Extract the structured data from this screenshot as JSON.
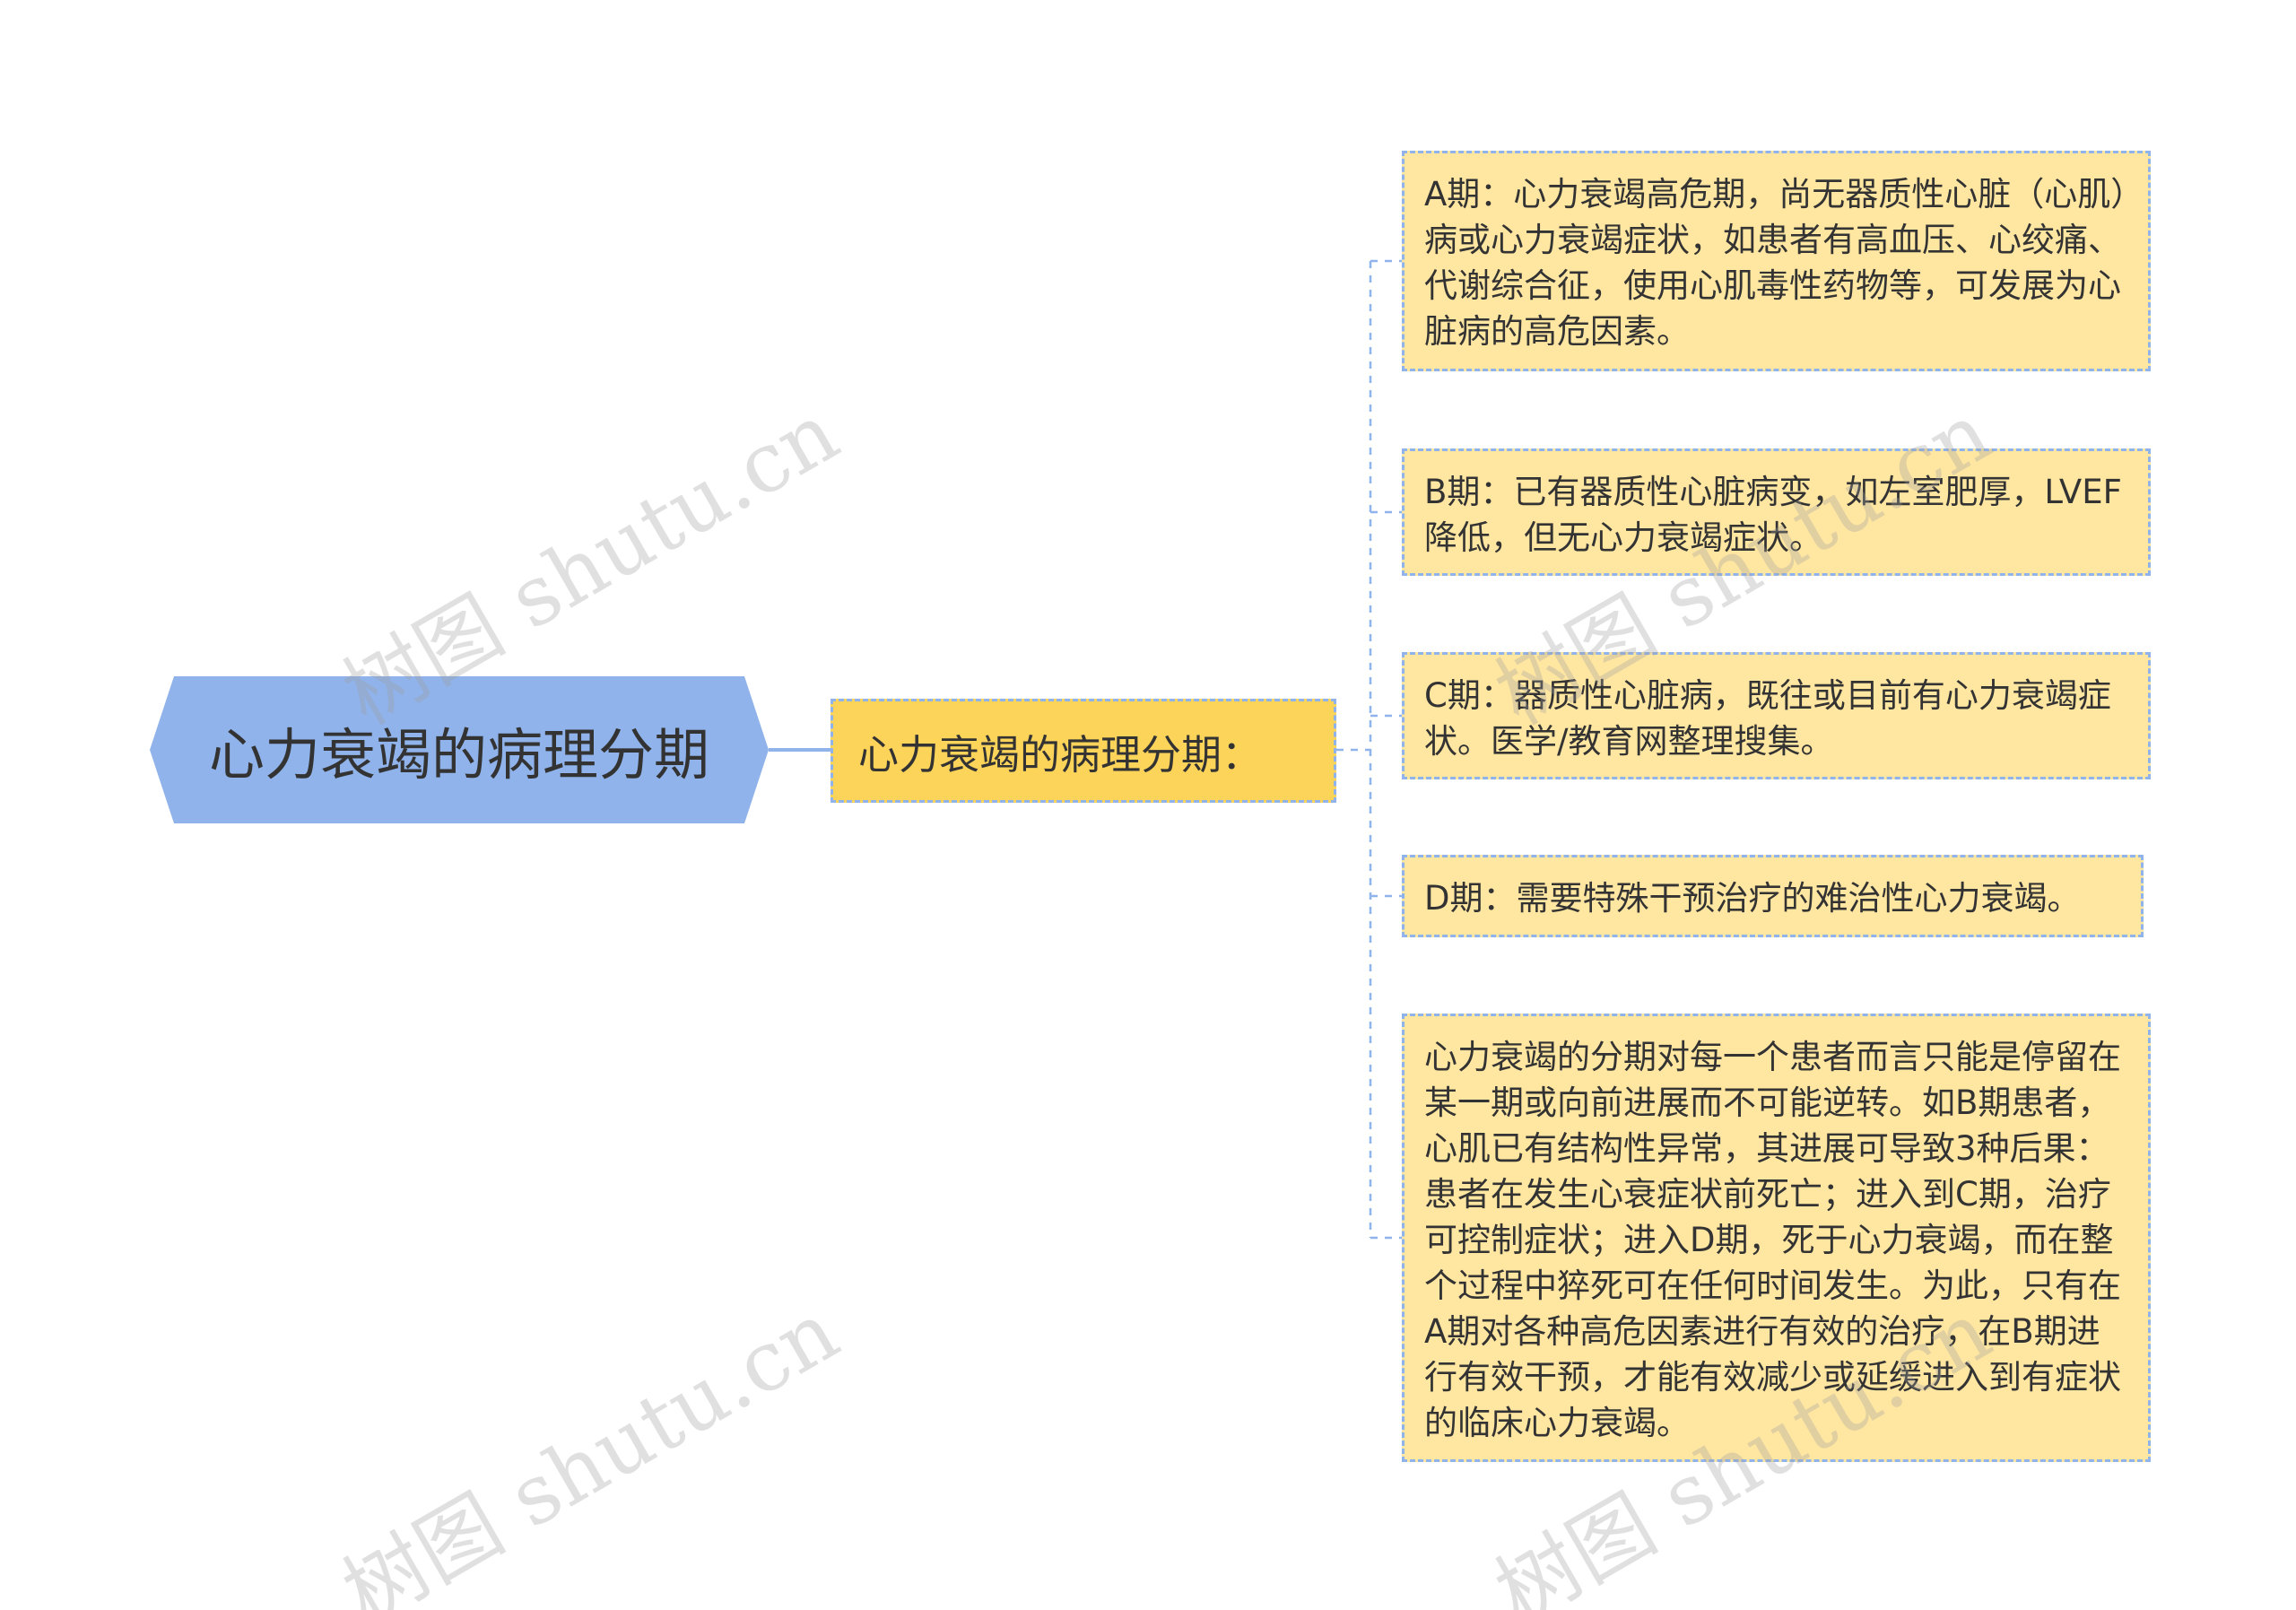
{
  "mindmap": {
    "root": {
      "label": "心力衰竭的病理分期"
    },
    "topic": {
      "label": "心力衰竭的病理分期："
    },
    "leaves": [
      {
        "id": "a",
        "text": "A期：心力衰竭高危期，尚无器质性心脏（心肌）病或心力衰竭症状，如患者有高血压、心绞痛、代谢综合征，使用心肌毒性药物等，可发展为心脏病的高危因素。"
      },
      {
        "id": "b",
        "text": "B期：已有器质性心脏病变，如左室肥厚，LVEF降低，但无心力衰竭症状。"
      },
      {
        "id": "c",
        "text": "C期：器质性心脏病，既往或目前有心力衰竭症状。医学/教育网整理搜集。"
      },
      {
        "id": "d",
        "text": "D期：需要特殊干预治疗的难治性心力衰竭。"
      },
      {
        "id": "e",
        "text": "心力衰竭的分期对每一个患者而言只能是停留在某一期或向前进展而不可能逆转。如B期患者，心肌已有结构性异常，其进展可导致3种后果：患者在发生心衰症状前死亡；进入到C期，治疗可控制症状；进入D期，死于心力衰竭，而在整个过程中猝死可在任何时间发生。为此，只有在A期对各种高危因素进行有效的治疗，在B期进行有效干预，才能有效减少或延缓进入到有症状的临床心力衰竭。"
      }
    ]
  },
  "watermark": {
    "text": "树图 shutu.cn"
  },
  "colors": {
    "root_fill": "#8fb3ea",
    "topic_fill": "#fdd45a",
    "leaf_fill": "#ffe6a1",
    "connector": "#8fb3ea",
    "text": "#333333"
  }
}
